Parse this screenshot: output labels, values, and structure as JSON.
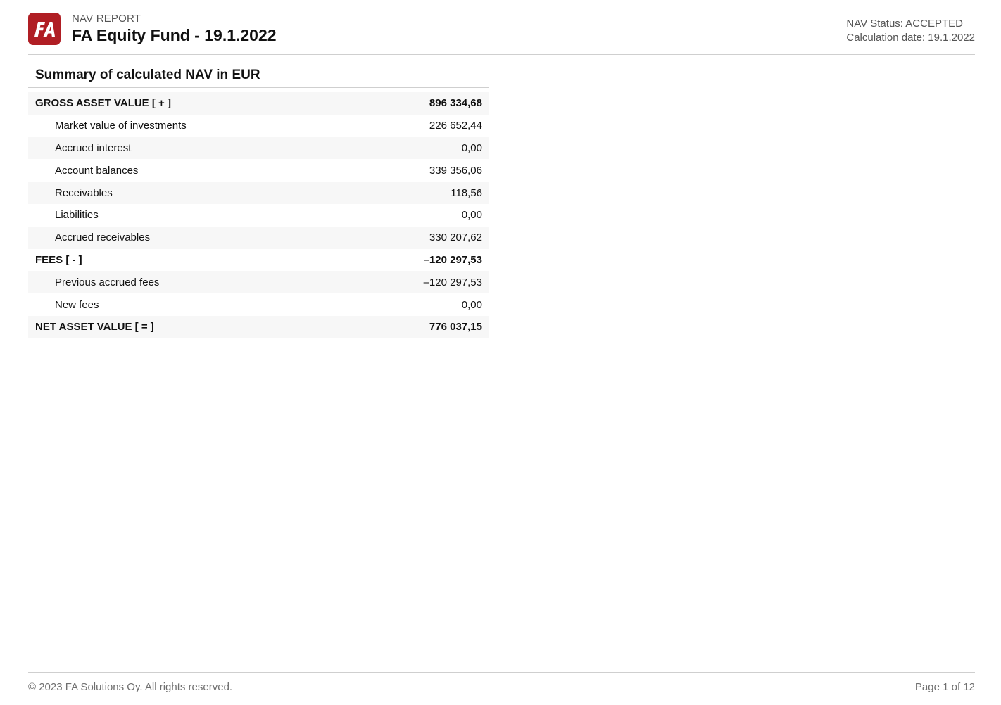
{
  "header": {
    "logo_text": "FA",
    "subtitle": "NAV REPORT",
    "title": "FA Equity Fund - 19.1.2022",
    "nav_status": "NAV Status: ACCEPTED",
    "calculation_date": "Calculation date: 19.1.2022"
  },
  "summary": {
    "title": "Summary of calculated NAV in EUR",
    "rows": [
      {
        "label": "GROSS ASSET VALUE [ + ]",
        "value": "896 334,68"
      },
      {
        "label": "Market value of investments",
        "value": "226 652,44"
      },
      {
        "label": "Accrued interest",
        "value": "0,00"
      },
      {
        "label": "Account balances",
        "value": "339 356,06"
      },
      {
        "label": "Receivables",
        "value": "118,56"
      },
      {
        "label": "Liabilities",
        "value": "0,00"
      },
      {
        "label": "Accrued receivables",
        "value": "330 207,62"
      },
      {
        "label": "FEES [ - ]",
        "value": "–120 297,53"
      },
      {
        "label": "Previous accrued fees",
        "value": "–120 297,53"
      },
      {
        "label": "New fees",
        "value": "0,00"
      },
      {
        "label": "NET ASSET VALUE [ = ]",
        "value": "776 037,15"
      }
    ]
  },
  "footer": {
    "copyright": "© 2023 FA Solutions Oy. All rights reserved.",
    "page": "Page 1 of 12"
  },
  "colors": {
    "brand": "#b01e24",
    "row_shade": "#f7f7f7",
    "muted_text": "#555555"
  }
}
